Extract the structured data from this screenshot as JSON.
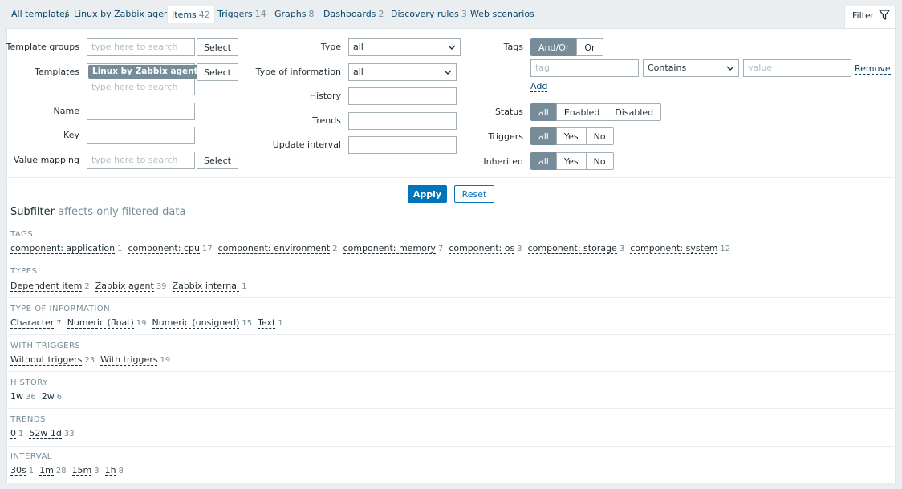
{
  "nav": {
    "all_templates": "All templates",
    "separator": "/",
    "template_name": "Linux by Zabbix agent",
    "tabs": [
      {
        "label": "Items",
        "count": "42"
      },
      {
        "label": "Triggers",
        "count": "14"
      },
      {
        "label": "Graphs",
        "count": "8"
      },
      {
        "label": "Dashboards",
        "count": "2"
      },
      {
        "label": "Discovery rules",
        "count": "3"
      },
      {
        "label": "Web scenarios",
        "count": ""
      }
    ],
    "filter_tab": "Filter"
  },
  "filter": {
    "template_groups": {
      "label": "Template groups",
      "placeholder": "type here to search",
      "button": "Select"
    },
    "templates": {
      "label": "Templates",
      "chip": "Linux by Zabbix agent",
      "chip_remove": "✕",
      "placeholder": "type here to search",
      "button": "Select"
    },
    "name": {
      "label": "Name",
      "value": ""
    },
    "key": {
      "label": "Key",
      "value": ""
    },
    "value_mapping": {
      "label": "Value mapping",
      "placeholder": "type here to search",
      "button": "Select"
    },
    "type": {
      "label": "Type",
      "value": "all"
    },
    "type_of_information": {
      "label": "Type of information",
      "value": "all"
    },
    "history": {
      "label": "History",
      "value": ""
    },
    "trends": {
      "label": "Trends",
      "value": ""
    },
    "update_interval": {
      "label": "Update interval",
      "value": ""
    },
    "tags": {
      "label": "Tags",
      "andor": "And/Or",
      "or": "Or",
      "tag_placeholder": "tag",
      "operator": "Contains",
      "value_placeholder": "value",
      "remove": "Remove",
      "add": "Add"
    },
    "status": {
      "label": "Status",
      "options": [
        "all",
        "Enabled",
        "Disabled"
      ]
    },
    "triggers": {
      "label": "Triggers",
      "options": [
        "all",
        "Yes",
        "No"
      ]
    },
    "inherited": {
      "label": "Inherited",
      "options": [
        "all",
        "Yes",
        "No"
      ]
    },
    "apply": "Apply",
    "reset": "Reset"
  },
  "subfilter": {
    "title": "Subfilter",
    "note": "affects only filtered data",
    "sections": [
      {
        "title": "TAGS",
        "entries": [
          {
            "label": "component: application",
            "count": "1"
          },
          {
            "label": "component: cpu",
            "count": "17"
          },
          {
            "label": "component: environment",
            "count": "2"
          },
          {
            "label": "component: memory",
            "count": "7"
          },
          {
            "label": "component: os",
            "count": "3"
          },
          {
            "label": "component: storage",
            "count": "3"
          },
          {
            "label": "component: system",
            "count": "12"
          }
        ]
      },
      {
        "title": "TYPES",
        "entries": [
          {
            "label": "Dependent item",
            "count": "2"
          },
          {
            "label": "Zabbix agent",
            "count": "39"
          },
          {
            "label": "Zabbix internal",
            "count": "1"
          }
        ]
      },
      {
        "title": "TYPE OF INFORMATION",
        "entries": [
          {
            "label": "Character",
            "count": "7"
          },
          {
            "label": "Numeric (float)",
            "count": "19"
          },
          {
            "label": "Numeric (unsigned)",
            "count": "15"
          },
          {
            "label": "Text",
            "count": "1"
          }
        ]
      },
      {
        "title": "WITH TRIGGERS",
        "entries": [
          {
            "label": "Without triggers",
            "count": "23"
          },
          {
            "label": "With triggers",
            "count": "19"
          }
        ]
      },
      {
        "title": "HISTORY",
        "entries": [
          {
            "label": "1w",
            "count": "36"
          },
          {
            "label": "2w",
            "count": "6"
          }
        ]
      },
      {
        "title": "TRENDS",
        "entries": [
          {
            "label": "0",
            "count": "1"
          },
          {
            "label": "52w 1d",
            "count": "33"
          }
        ]
      },
      {
        "title": "INTERVAL",
        "entries": [
          {
            "label": "30s",
            "count": "1"
          },
          {
            "label": "1m",
            "count": "28"
          },
          {
            "label": "15m",
            "count": "3"
          },
          {
            "label": "1h",
            "count": "8"
          }
        ]
      }
    ]
  }
}
